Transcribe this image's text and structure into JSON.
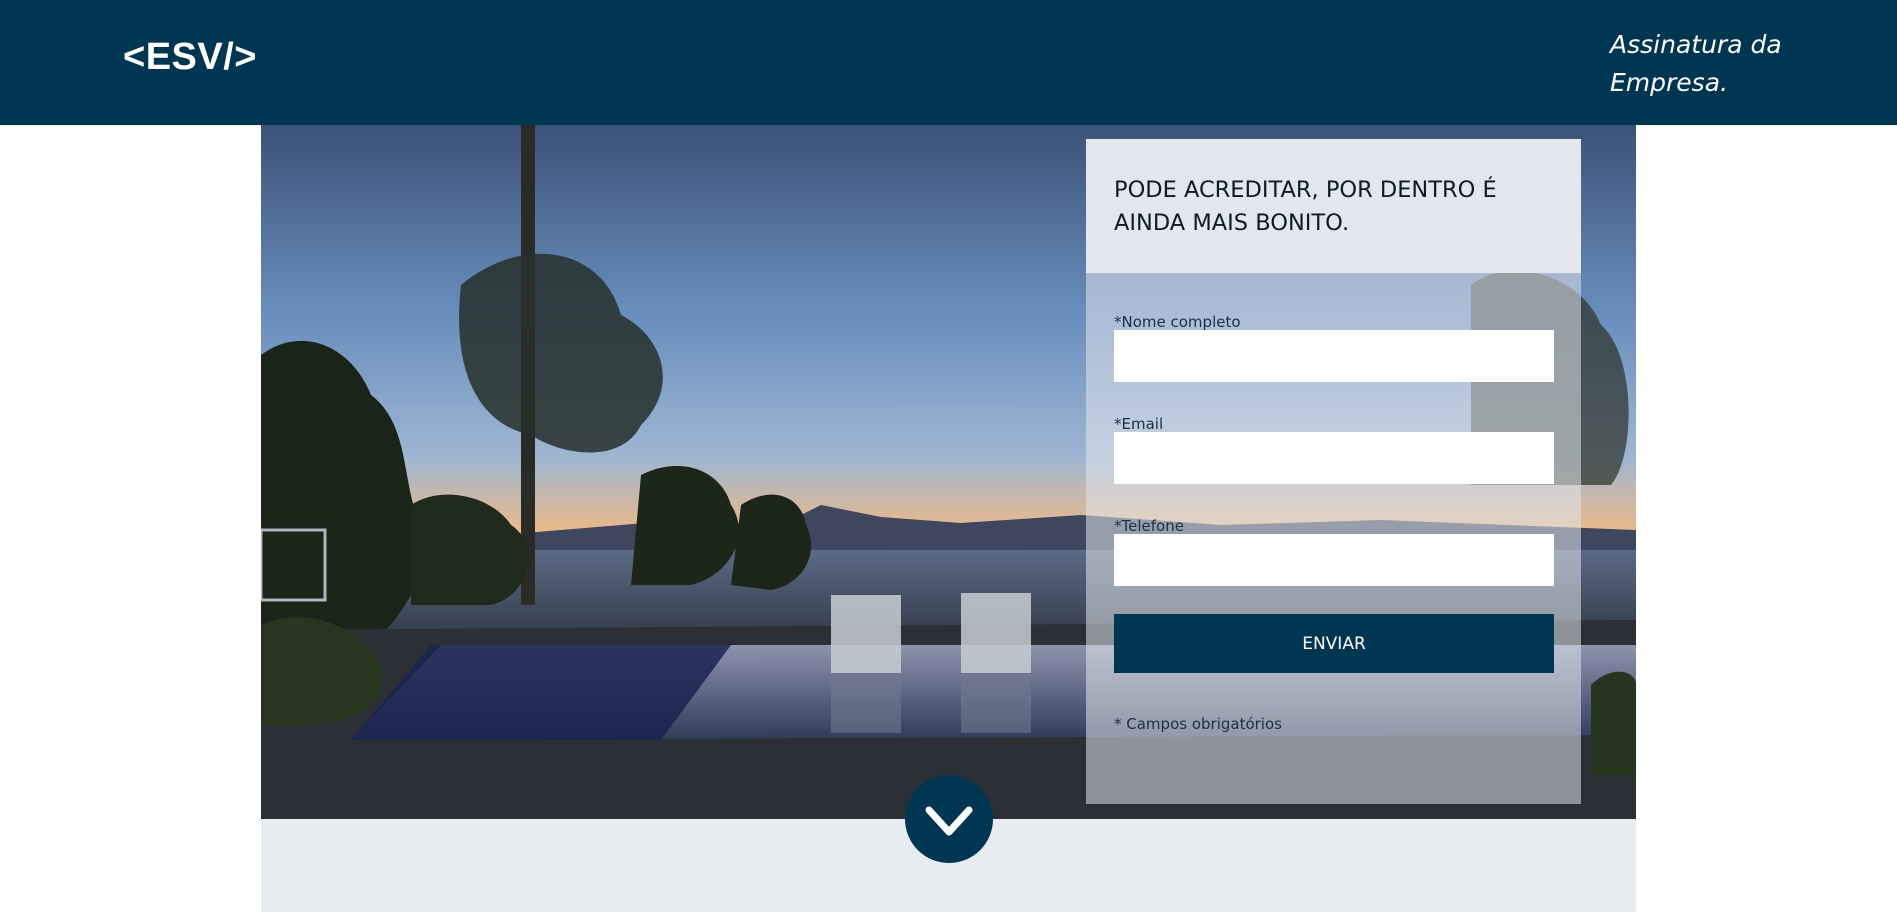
{
  "header": {
    "logo": "<ESV/>",
    "signature": "Assinatura da Empresa."
  },
  "form": {
    "title": "PODE ACREDITAR, POR DENTRO É AINDA MAIS BONITO.",
    "fields": [
      {
        "label": "*Nome completo",
        "value": "",
        "placeholder": ""
      },
      {
        "label": "*Email",
        "value": "",
        "placeholder": ""
      },
      {
        "label": "*Telefone",
        "value": "",
        "placeholder": ""
      }
    ],
    "submit_label": "ENVIAR",
    "required_note": "* Campos obrigatórios"
  },
  "icons": {
    "scroll": "chevron-down-icon"
  },
  "colors": {
    "brand": "#003652",
    "form_background": "#e1e5eb",
    "lower_section": "#e8ecf0"
  }
}
